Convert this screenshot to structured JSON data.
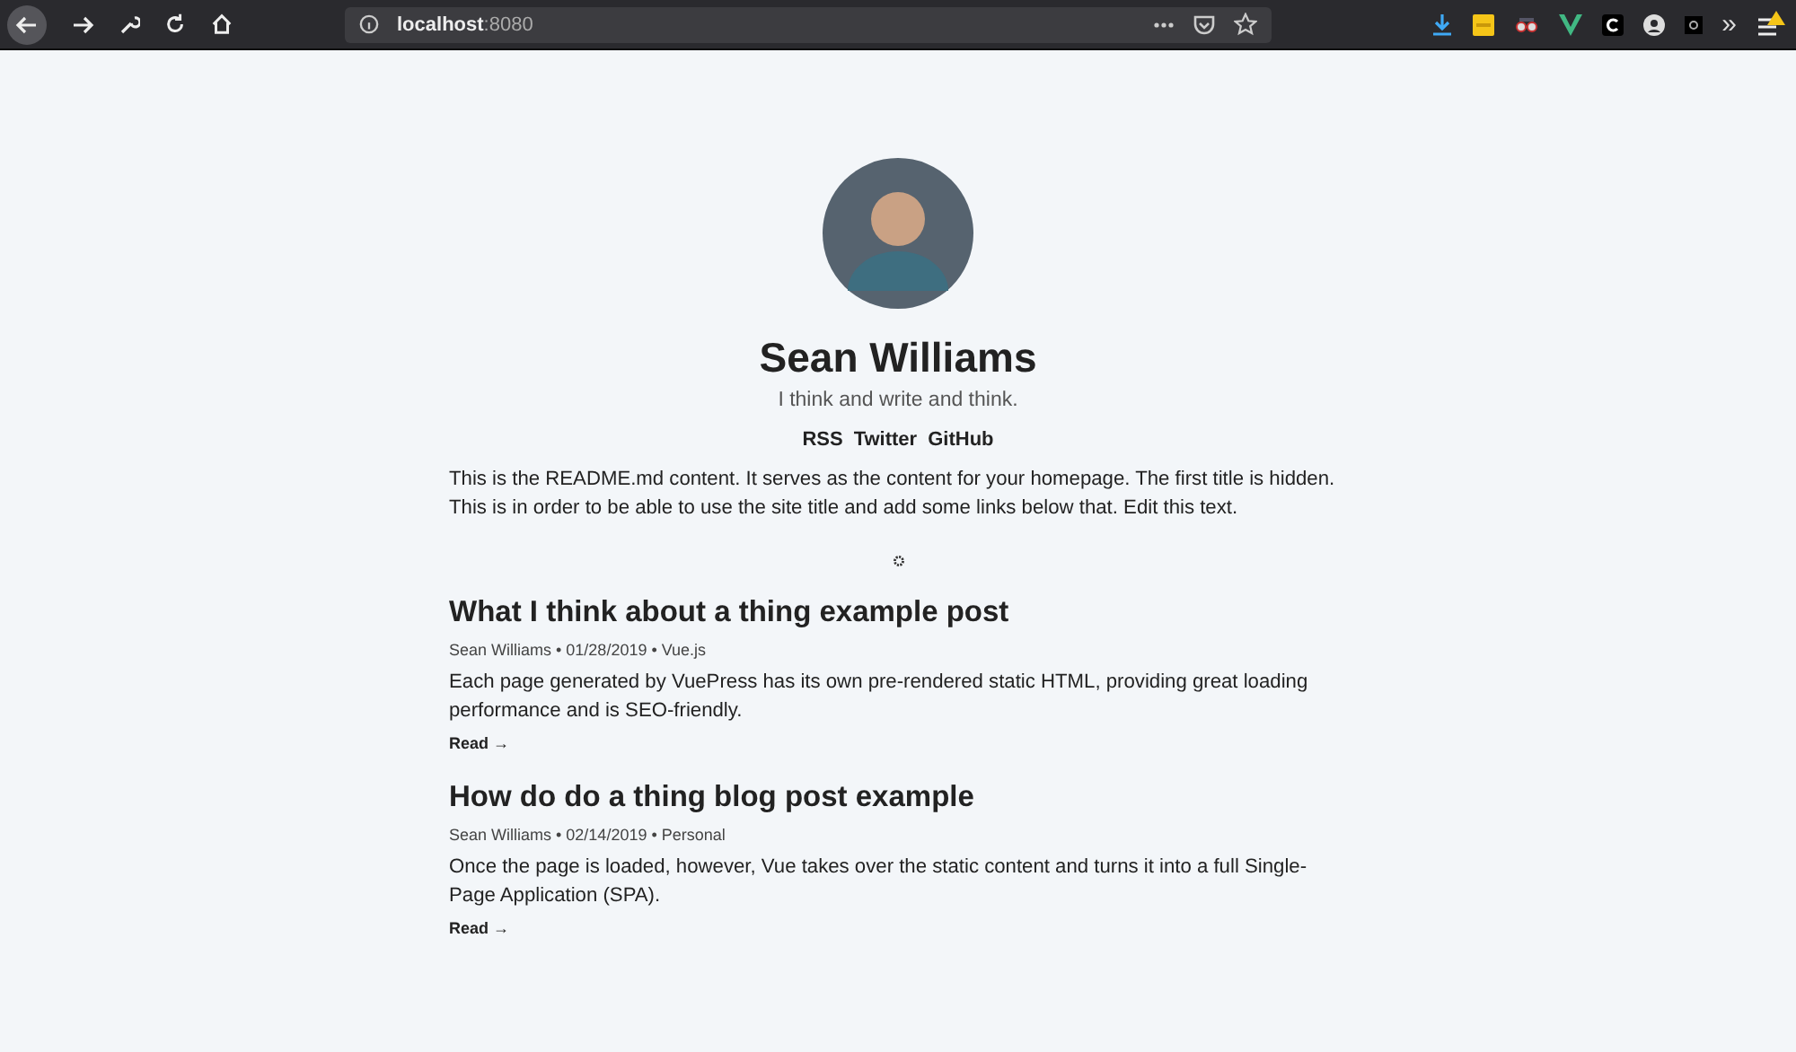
{
  "browser": {
    "url_host": "localhost",
    "url_port": ":8080",
    "extension_more": "»"
  },
  "profile": {
    "name": "Sean Williams",
    "tagline": "I think and write and think.",
    "links": [
      "RSS",
      "Twitter",
      "GitHub"
    ]
  },
  "intro": "This is the README.md content. It serves as the content for your homepage. The first title is hidden. This is in order to be able to use the site title and add some links below that. Edit this text.",
  "posts": [
    {
      "title": "What I think about a thing example post",
      "meta": "Sean Williams • 01/28/2019 • Vue.js",
      "excerpt": "Each page generated by VuePress has its own pre-rendered static HTML, providing great loading performance and is SEO-friendly.",
      "read": "Read →"
    },
    {
      "title": "How do do a thing blog post example",
      "meta": "Sean Williams • 02/14/2019 • Personal",
      "excerpt": "Once the page is loaded, however, Vue takes over the static content and turns it into a full Single-Page Application (SPA).",
      "read": "Read →"
    }
  ]
}
